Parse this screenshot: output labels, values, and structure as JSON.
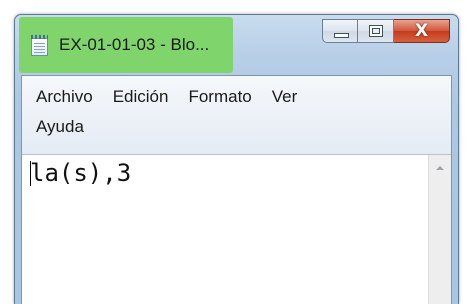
{
  "window": {
    "title": "EX-01-01-03 - Blo...",
    "icon": "notepad-icon"
  },
  "caption_buttons": {
    "minimize": "minimize-icon",
    "maximize": "maximize-icon",
    "close": "X"
  },
  "menu": {
    "items": [
      "Archivo",
      "Edición",
      "Formato",
      "Ver",
      "Ayuda"
    ]
  },
  "editor": {
    "content": "la(s),3"
  },
  "colors": {
    "highlight": "#7fd46b",
    "close_button": "#c43b1d"
  }
}
